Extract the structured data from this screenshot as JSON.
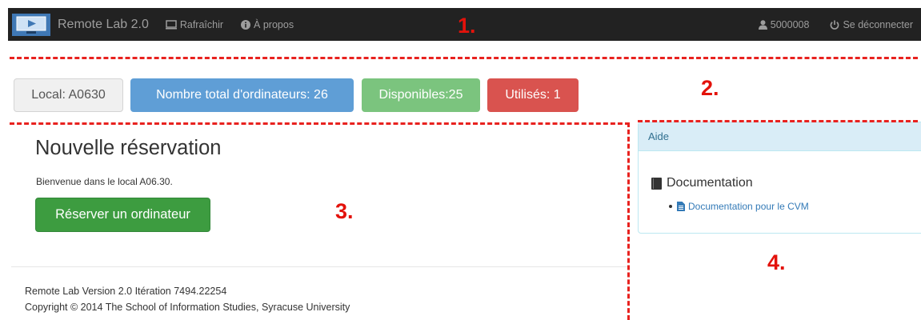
{
  "navbar": {
    "brand": "Remote Lab 2.0",
    "refresh": "Rafraîchir",
    "about": "À propos",
    "user": "5000008",
    "logout": "Se déconnecter"
  },
  "stats": {
    "local": "Local: A0630",
    "total": "Nombre total d'ordinateurs: 26",
    "available": "Disponibles:25",
    "used": "Utilisés: 1"
  },
  "main": {
    "title": "Nouvelle réservation",
    "welcome": "Bienvenue dans le local A06.30.",
    "reserve_button": "Réserver un ordinateur"
  },
  "help": {
    "heading": "Aide",
    "doc_title": "Documentation",
    "doc_link": "Documentation pour le CVM"
  },
  "footer": {
    "version": "Remote Lab Version 2.0 Itération 7494.22254",
    "copyright": "Copyright © 2014 The School of Information Studies, Syracuse University"
  },
  "annotations": {
    "n1": "1.",
    "n2": "2.",
    "n3": "3.",
    "n4": "4."
  },
  "colors": {
    "navbar_bg": "#222222",
    "annotation_red": "#e3120b",
    "total_blue": "#5f9ed6",
    "available_green": "#7bc47e",
    "used_red": "#d9534f",
    "reserve_green": "#3d9c40",
    "help_heading_bg": "#d9edf7"
  },
  "icons": {
    "logo": "monitor-logo-icon",
    "refresh": "monitor-icon",
    "about": "info-circle-icon",
    "user": "user-icon",
    "logout": "power-icon",
    "documentation": "book-icon",
    "doc_link": "file-icon"
  }
}
